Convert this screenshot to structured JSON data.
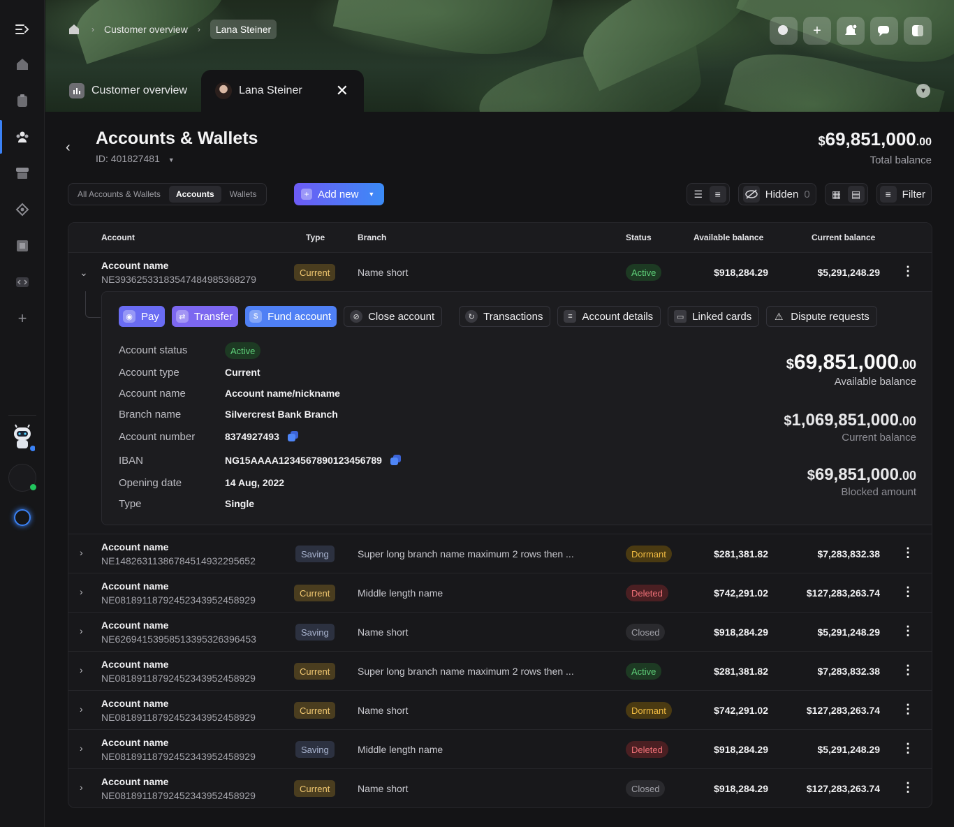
{
  "breadcrumb": {
    "items": [
      "Customer overview",
      "Lana Steiner"
    ]
  },
  "tabs": [
    {
      "label": "Customer overview"
    },
    {
      "label": "Lana Steiner"
    }
  ],
  "page": {
    "title": "Accounts & Wallets",
    "id_label": "ID: 401827481",
    "total_balance": {
      "symbol": "$",
      "whole": "69,851,000",
      "decimal": ".00",
      "label": "Total balance"
    }
  },
  "toolbar": {
    "segments": [
      "All Accounts & Wallets",
      "Accounts",
      "Wallets"
    ],
    "active_segment": "Accounts",
    "add_new": "Add new",
    "hidden_label": "Hidden",
    "hidden_count": "0",
    "filter": "Filter"
  },
  "table": {
    "headers": [
      "Account",
      "Type",
      "Branch",
      "Status",
      "Available balance",
      "Current balance"
    ],
    "rows": [
      {
        "name": "Account name",
        "number": "NE3936253318354748498536827 9",
        "type": "Current",
        "branch": "Name short",
        "status": "Active",
        "available": "$918,284.29",
        "current": "$5,291,248.29"
      },
      {
        "name": "Account name",
        "number": "NE148263113867845149322956 52",
        "type": "Saving",
        "branch": "Super long branch name  maximum 2 rows then ...",
        "status": "Dormant",
        "available": "$281,381.82",
        "current": "$7,283,832.38"
      },
      {
        "name": "Account name",
        "number": "NE081891187924523439524589 29",
        "type": "Current",
        "branch": "Middle length name",
        "status": "Deleted",
        "available": "$742,291.02",
        "current": "$127,283,263.74"
      },
      {
        "name": "Account name",
        "number": "NE626941539585133953263964 53",
        "type": "Saving",
        "branch": "Name short",
        "status": "Closed",
        "available": "$918,284.29",
        "current": "$5,291,248.29"
      },
      {
        "name": "Account name",
        "number": "NE081891187924523439524589 29",
        "type": "Current",
        "branch": "Super long branch name  maximum 2 rows then ...",
        "status": "Active",
        "available": "$281,381.82",
        "current": "$7,283,832.38"
      },
      {
        "name": "Account name",
        "number": "NE081891187924523439524589 29",
        "type": "Current",
        "branch": "Name short",
        "status": "Dormant",
        "available": "$742,291.02",
        "current": "$127,283,263.74"
      },
      {
        "name": "Account name",
        "number": "NE081891187924523439524589 29",
        "type": "Saving",
        "branch": "Middle length name",
        "status": "Deleted",
        "available": "$918,284.29",
        "current": "$5,291,248.29"
      },
      {
        "name": "Account name",
        "number": "NE081891187924523439524589 29",
        "type": "Current",
        "branch": "Name short",
        "status": "Closed",
        "available": "$918,284.29",
        "current": "$127,283,263.74"
      }
    ]
  },
  "detail": {
    "actions": [
      "Pay",
      "Transfer",
      "Fund account",
      "Close account",
      "Transactions",
      "Account details",
      "Linked cards",
      "Dispute requests"
    ],
    "fields": [
      {
        "label": "Account status",
        "value": "Active"
      },
      {
        "label": "Account type",
        "value": "Current"
      },
      {
        "label": "Account name",
        "value": "Account name/nickname"
      },
      {
        "label": "Branch name",
        "value": "Silvercrest Bank Branch"
      },
      {
        "label": "Account number",
        "value": "8374927493"
      },
      {
        "label": "IBAN",
        "value": "NG15AAAA1234567890123456789"
      },
      {
        "label": "Opening date",
        "value": "14 Aug, 2022"
      },
      {
        "label": "Type",
        "value": "Single"
      }
    ],
    "balances": [
      {
        "symbol": "$",
        "whole": "69,851,000",
        "decimal": ".00",
        "label": "Available balance"
      },
      {
        "symbol": "$",
        "whole": "1,069,851,000",
        "decimal": ".00",
        "label": "Current balance"
      },
      {
        "symbol": "$",
        "whole": "69,851,000",
        "decimal": ".00",
        "label": "Blocked amount"
      }
    ]
  },
  "colors": {
    "accent": "#3b82f6",
    "active": "#5fd07a",
    "dormant": "#f2bc42",
    "deleted": "#f07178"
  }
}
